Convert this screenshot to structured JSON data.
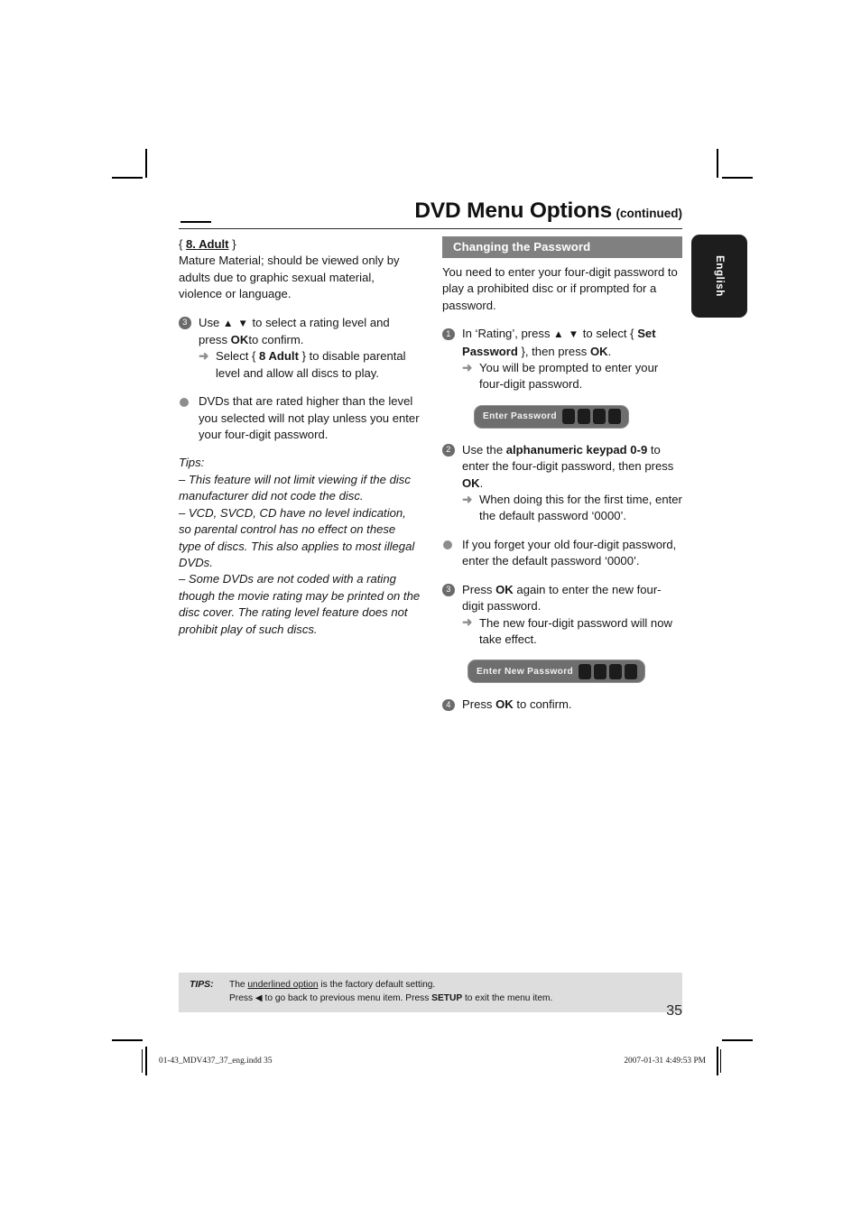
{
  "header": {
    "title": "DVD Menu Options",
    "continued": "(continued)"
  },
  "language_tab": {
    "label": "English"
  },
  "left_column": {
    "rating_option": {
      "open_brace": "{",
      "label": "8. Adult",
      "close_brace": "}",
      "description": "Mature Material; should be viewed only by adults due to graphic sexual material, violence or language."
    },
    "step3": {
      "number": "3",
      "text_a": "Use",
      "triangles": "▲ ▼",
      "text_b": "to select a rating level and press",
      "bold_ok": "OK",
      "text_c": "to confirm.",
      "sub_arrow": "➜",
      "sub_a": "Select {",
      "sub_bold": "8 Adult",
      "sub_b": "} to disable parental level and allow all discs to play."
    },
    "note_bullet": "DVDs that are rated higher than the level you selected will not play unless you enter your four-digit password.",
    "tips_heading": "Tips:",
    "tips_items": [
      "–  This feature will not limit viewing if the disc manufacturer did not code the disc.",
      "–  VCD, SVCD, CD have no level indication, so parental control has no effect on these type of discs. This also applies to most illegal DVDs.",
      "–  Some DVDs are not coded with a rating though the movie rating may be printed on the disc cover. The rating level feature does not prohibit play of such discs."
    ]
  },
  "right_column": {
    "section_title": "Changing the Password",
    "intro": "You need to enter your four-digit password to play a prohibited disc or if prompted for a password.",
    "step1": {
      "number": "1",
      "text_a": "In ‘Rating’, press",
      "triangles": "▲ ▼",
      "text_b": "to select {",
      "bold": "Set Password",
      "text_c": "}, then press",
      "bold_ok": "OK",
      "text_d": ".",
      "sub_arrow": "➜",
      "sub_text": "You will be prompted to enter your four-digit password."
    },
    "password_widget_1": {
      "label": "Enter Password",
      "box_count": 4
    },
    "step2": {
      "number": "2",
      "text_a": "Use the",
      "bold": "alphanumeric keypad 0-9",
      "text_b": "to enter the four-digit password, then press",
      "bold_ok": "OK",
      "text_c": ".",
      "sub_arrow": "➜",
      "sub_text": "When doing this for the first time, enter the default password ‘0000’."
    },
    "forget_bullet": "If you forget your old four-digit password, enter the default password ‘0000’.",
    "step3": {
      "number": "3",
      "text_a": "Press",
      "bold_ok": "OK",
      "text_b": "again to enter the new four-digit password.",
      "sub_arrow": "➜",
      "sub_text": "The new four-digit password will now take effect."
    },
    "password_widget_2": {
      "label": "Enter New Password",
      "box_count": 4
    },
    "step4": {
      "number": "4",
      "text_a": "Press",
      "bold_ok": "OK",
      "text_b": "to confirm."
    }
  },
  "tips_box": {
    "label": "TIPS:",
    "line1_a": "The ",
    "line1_underlined": "underlined option",
    "line1_b": " is the factory default setting.",
    "line2_a": "Press  ",
    "line2_triangle": "◀",
    "line2_b": " to go back to previous menu item. Press ",
    "line2_bold": "SETUP",
    "line2_c": " to exit the menu item."
  },
  "page_number": "35",
  "print_footer": {
    "left": "01-43_MDV437_37_eng.indd   35",
    "right": "2007-01-31   4:49:53 PM"
  },
  "colors": {
    "banner_gray": "#808080",
    "bullet_gray": "#6b6b6b",
    "dot_gray": "#8d8d8d",
    "widget_gray": "#6e6e6e",
    "widget_box_dark": "#1c1c1c",
    "tips_bg": "#dddddd",
    "tab_black": "#1d1d1d"
  }
}
